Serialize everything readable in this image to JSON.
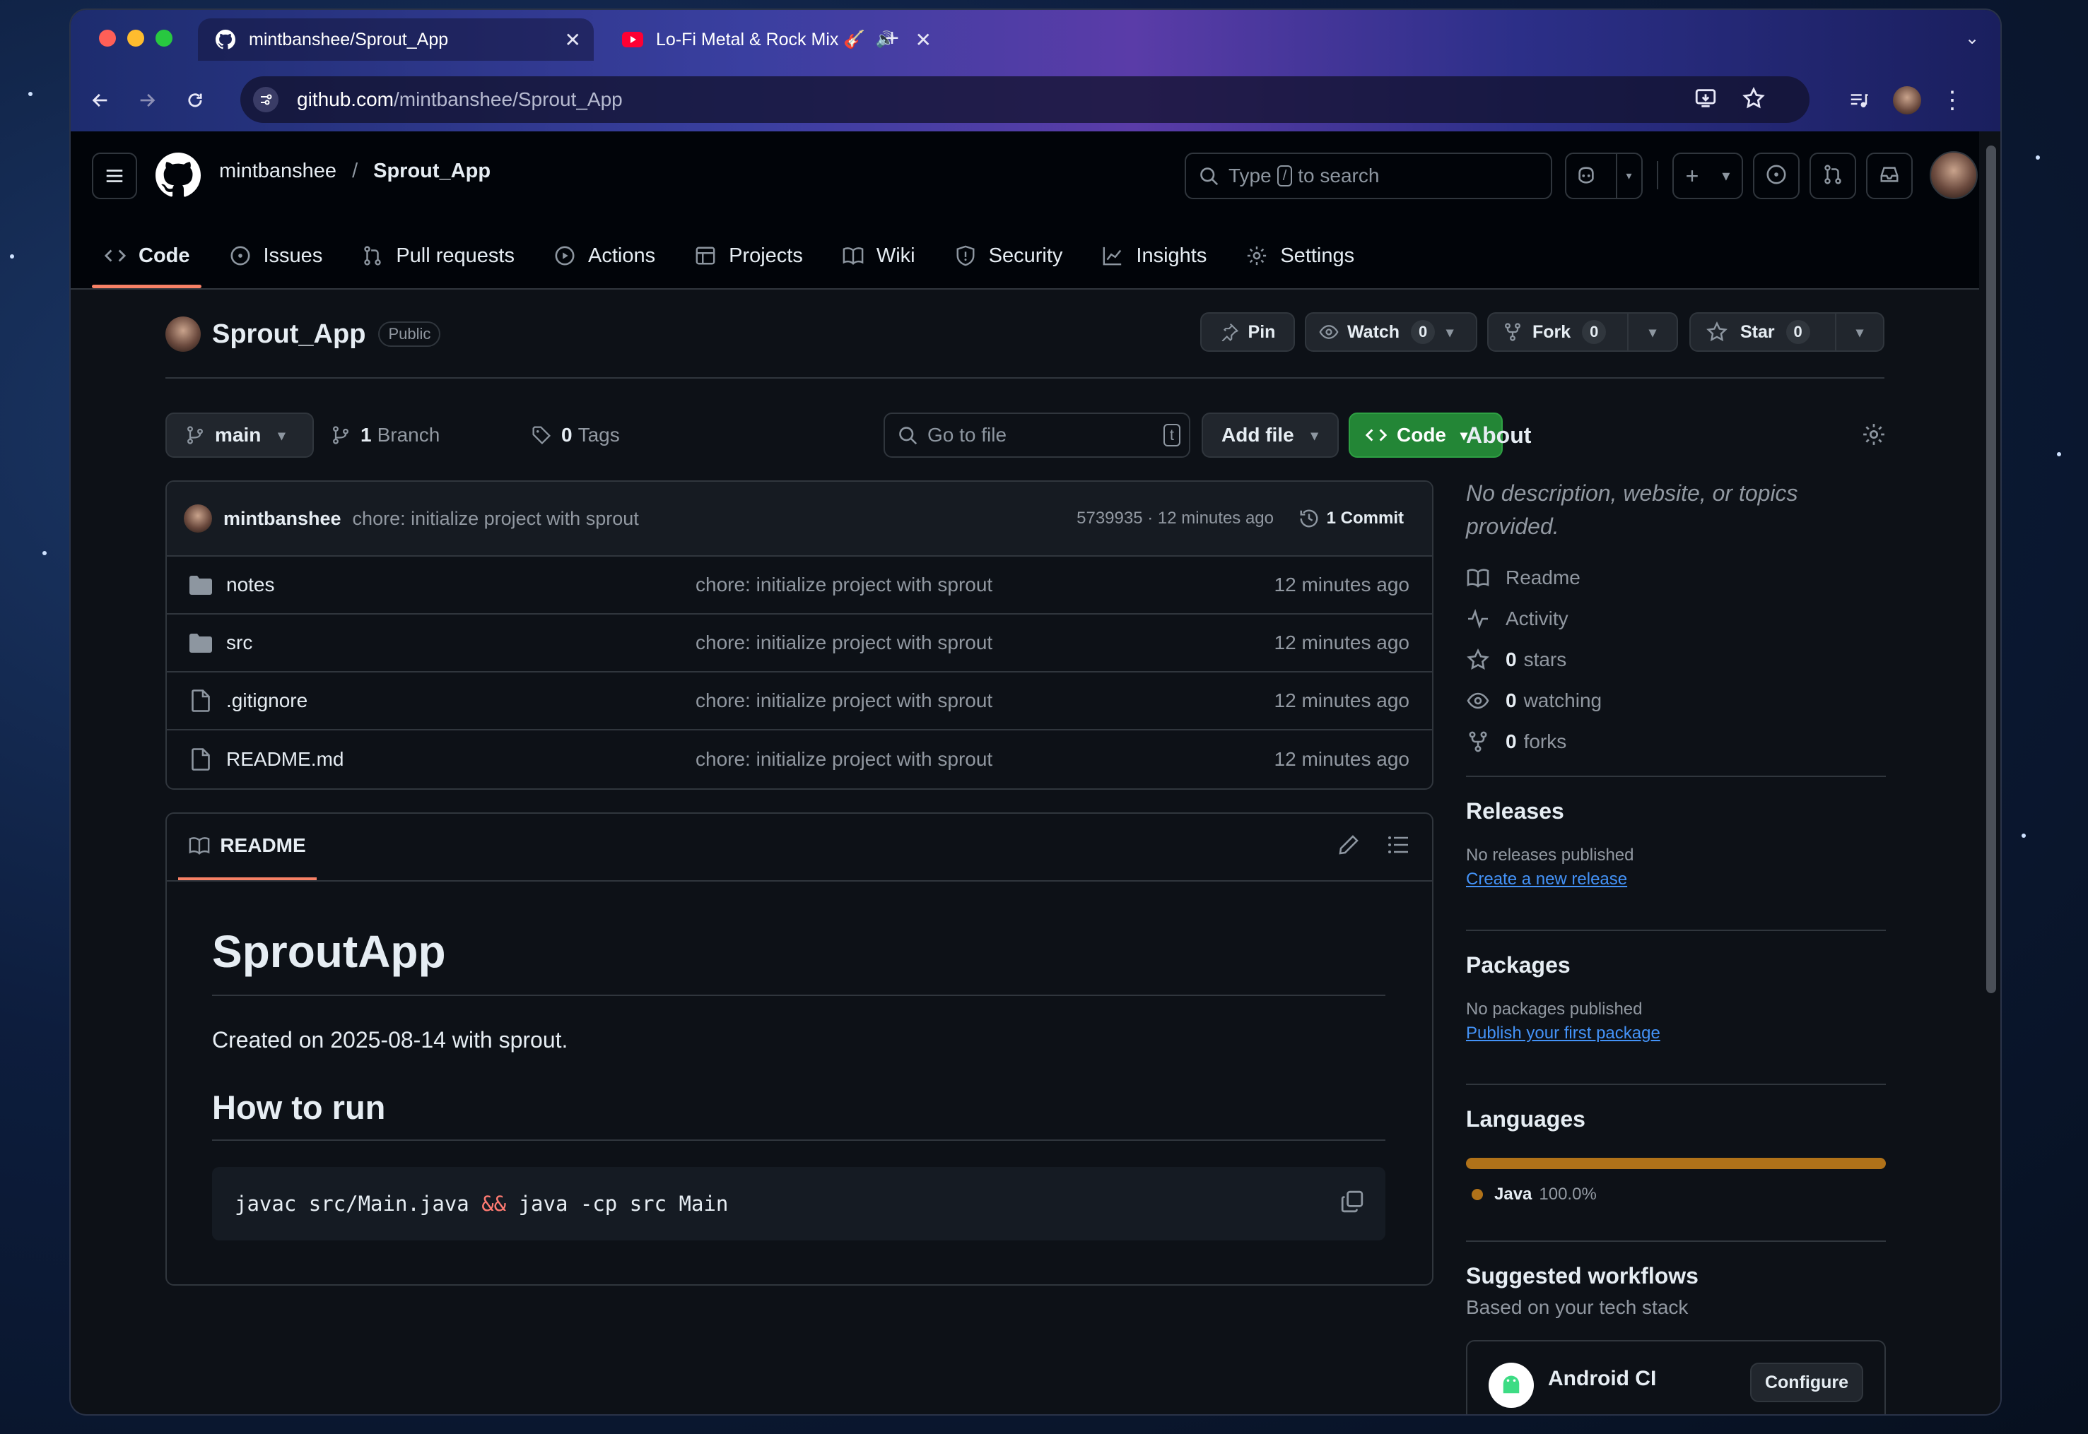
{
  "browser": {
    "tabs": [
      {
        "title": "mintbanshee/Sprout_App",
        "active": true
      },
      {
        "title": "Lo-Fi Metal & Rock Mix 🎸",
        "active": false
      }
    ],
    "url_host": "github.com",
    "url_path": "/mintbanshee/Sprout_App"
  },
  "header": {
    "owner": "mintbanshee",
    "sep": "/",
    "repo": "Sprout_App",
    "search_prefix": "Type",
    "search_key": "/",
    "search_suffix": "to search"
  },
  "repo_nav": {
    "tabs": [
      "Code",
      "Issues",
      "Pull requests",
      "Actions",
      "Projects",
      "Wiki",
      "Security",
      "Insights",
      "Settings"
    ]
  },
  "repo": {
    "name": "Sprout_App",
    "visibility": "Public",
    "pin": "Pin",
    "watch": "Watch",
    "watch_count": "0",
    "fork": "Fork",
    "fork_count": "0",
    "star": "Star",
    "star_count": "0"
  },
  "toolbar": {
    "branch": "main",
    "branches_count": "1",
    "branches_label": "Branch",
    "tags_count": "0",
    "tags_label": "Tags",
    "goto_placeholder": "Go to file",
    "goto_key": "t",
    "add_file": "Add file",
    "code": "Code"
  },
  "latest_commit": {
    "author": "mintbanshee",
    "message": "chore: initialize project with sprout",
    "hash_time": "5739935 · 12 minutes ago",
    "commits": "1 Commit"
  },
  "files": [
    {
      "name": "notes",
      "type": "dir",
      "message": "chore: initialize project with sprout",
      "time": "12 minutes ago"
    },
    {
      "name": "src",
      "type": "dir",
      "message": "chore: initialize project with sprout",
      "time": "12 minutes ago"
    },
    {
      "name": ".gitignore",
      "type": "file",
      "message": "chore: initialize project with sprout",
      "time": "12 minutes ago"
    },
    {
      "name": "README.md",
      "type": "file",
      "message": "chore: initialize project with sprout",
      "time": "12 minutes ago"
    }
  ],
  "readme": {
    "tab": "README",
    "title": "SproutApp",
    "created": "Created on 2025-08-14 with sprout.",
    "howto": "How to run",
    "code_a": "javac src/Main.java ",
    "code_op": "&&",
    "code_b": " java -cp src Main"
  },
  "about": {
    "title": "About",
    "description": "No description, website, or topics provided.",
    "readme": "Readme",
    "activity": "Activity",
    "stars_n": "0",
    "stars_l": "stars",
    "watching_n": "0",
    "watching_l": "watching",
    "forks_n": "0",
    "forks_l": "forks"
  },
  "releases": {
    "title": "Releases",
    "none": "No releases published",
    "link": "Create a new release"
  },
  "packages": {
    "title": "Packages",
    "none": "No packages published",
    "link": "Publish your first package"
  },
  "languages": {
    "title": "Languages",
    "name": "Java",
    "percent": "100.0%",
    "share": 1.0,
    "color": "#b07219"
  },
  "workflows": {
    "title": "Suggested workflows",
    "subtitle": "Based on your tech stack",
    "item": "Android CI",
    "configure": "Configure"
  },
  "colors": {
    "accent": "#f78166",
    "primary_btn": "#238636",
    "link": "#4493f8"
  }
}
